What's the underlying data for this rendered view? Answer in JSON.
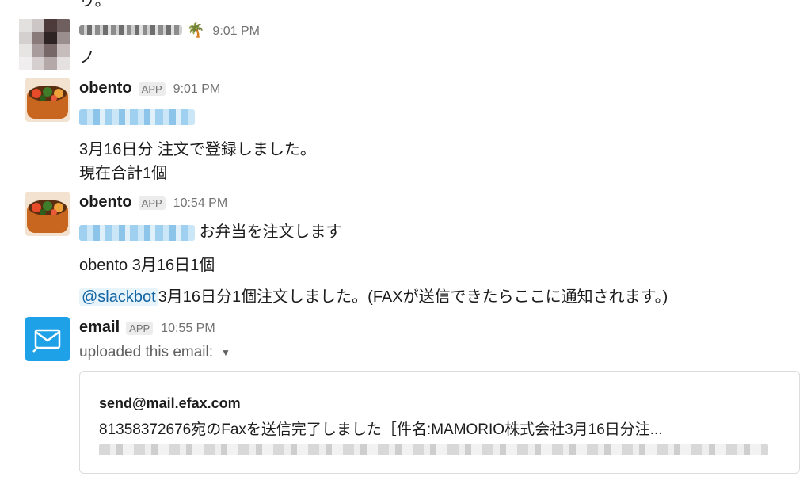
{
  "top_fragment": "り。",
  "messages": [
    {
      "sender": "",
      "emoji": "🌴",
      "time": "9:01 PM",
      "lines": [
        "ノ"
      ]
    },
    {
      "sender": "obento",
      "badge": "APP",
      "time": "9:01 PM",
      "lines": [
        "3月16日分 注文で登録しました。",
        "現在合計1個"
      ]
    },
    {
      "sender": "obento",
      "badge": "APP",
      "time": "10:54 PM",
      "line1_suffix": "お弁当を注文します",
      "line2": "obento 3月16日1個",
      "mention": "@slackbot",
      "line3_rest": "3月16日分1個注文しました。(FAXが送信できたらここに通知されます。)"
    },
    {
      "sender": "email",
      "badge": "APP",
      "time": "10:55 PM",
      "uploaded_text": "uploaded this email:",
      "attachment": {
        "from": "send@mail.efax.com",
        "subject": "81358372676宛のFaxを送信完了しました［件名:MAMORIO株式会社3月16日分注..."
      }
    }
  ],
  "colors": {
    "link": "#1264a3",
    "email_icon_bg": "#1fa1e8",
    "muted": "#717274"
  }
}
